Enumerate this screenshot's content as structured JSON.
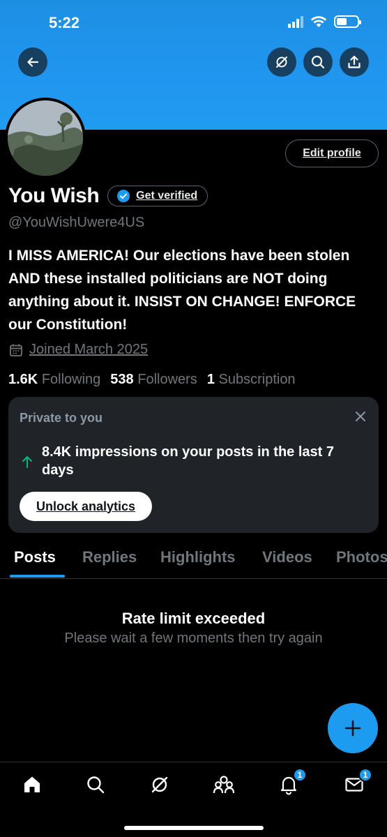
{
  "status_bar": {
    "time": "5:22"
  },
  "header": {
    "back_icon": "arrow-left-icon",
    "grok_icon": "grok-icon",
    "search_icon": "search-icon",
    "share_icon": "share-icon"
  },
  "profile": {
    "display_name": "You Wish",
    "get_verified_label": "Get verified",
    "handle": "@YouWishUwere4US",
    "bio": "I MISS AMERICA! Our elections have been stolen AND these installed politicians are NOT doing anything about it. INSIST ON CHANGE! ENFORCE our Constitution!",
    "joined": "Joined March 2025",
    "edit_profile_label": "Edit profile",
    "stats": {
      "following_count": "1.6K",
      "following_label": "Following",
      "followers_count": "538",
      "followers_label": "Followers",
      "subscription_count": "1",
      "subscription_label": "Subscription"
    }
  },
  "analytics_card": {
    "title": "Private to you",
    "text": "8.4K impressions on your posts in the last 7 days",
    "button_label": "Unlock analytics"
  },
  "tabs": [
    {
      "label": "Posts",
      "active": true
    },
    {
      "label": "Replies"
    },
    {
      "label": "Highlights"
    },
    {
      "label": "Videos"
    },
    {
      "label": "Photos"
    }
  ],
  "empty_state": {
    "title": "Rate limit exceeded",
    "subtitle": "Please wait a few moments then try again"
  },
  "bottom_nav": {
    "notifications_badge": "1",
    "messages_badge": "1"
  },
  "colors": {
    "accent": "#1d9bf0",
    "background": "#000000",
    "muted": "#71767b"
  }
}
